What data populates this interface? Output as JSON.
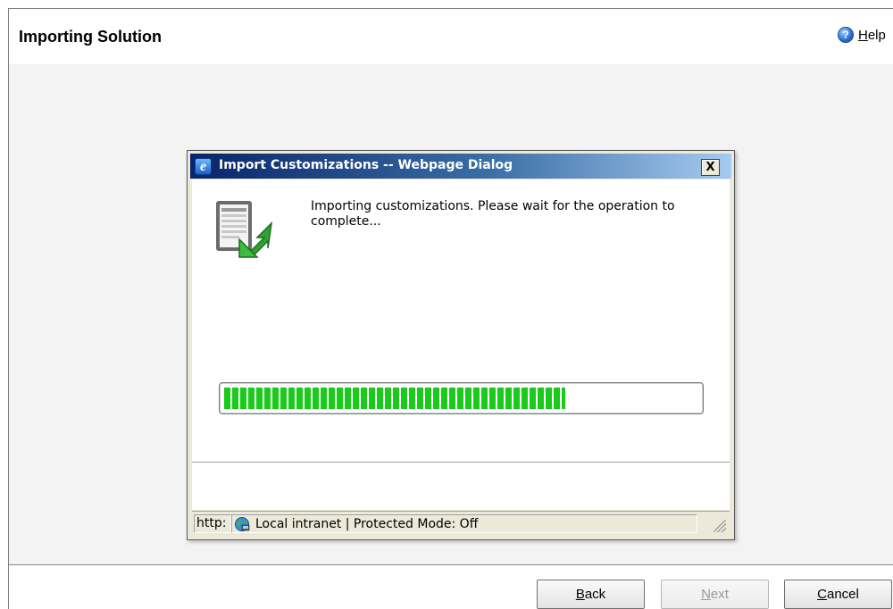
{
  "page": {
    "title": "Importing Solution",
    "help_label_underlined": "H",
    "help_label_rest": "elp"
  },
  "dialog": {
    "title": "Import Customizations -- Webpage Dialog",
    "close_glyph": "X",
    "message": "Importing customizations. Please wait for the operation to complete...",
    "progress_fraction": 0.72
  },
  "status_bar": {
    "protocol": "http:",
    "zone_text": "Local intranet | Protected Mode: Off"
  },
  "footer": {
    "back": {
      "u": "B",
      "rest": "ack",
      "enabled": true
    },
    "next": {
      "u": "N",
      "rest": "ext",
      "enabled": false
    },
    "cancel": {
      "u": "C",
      "rest": "ancel",
      "enabled": true
    }
  },
  "icons": {
    "help": "help-icon",
    "ie": "internet-explorer-icon",
    "import": "import-customizations-icon",
    "zone": "local-intranet-globe-icon"
  },
  "colors": {
    "progress_green": "#19cc19",
    "titlebar_dark": "#0a246a",
    "body_bg": "#f3f3f4"
  }
}
